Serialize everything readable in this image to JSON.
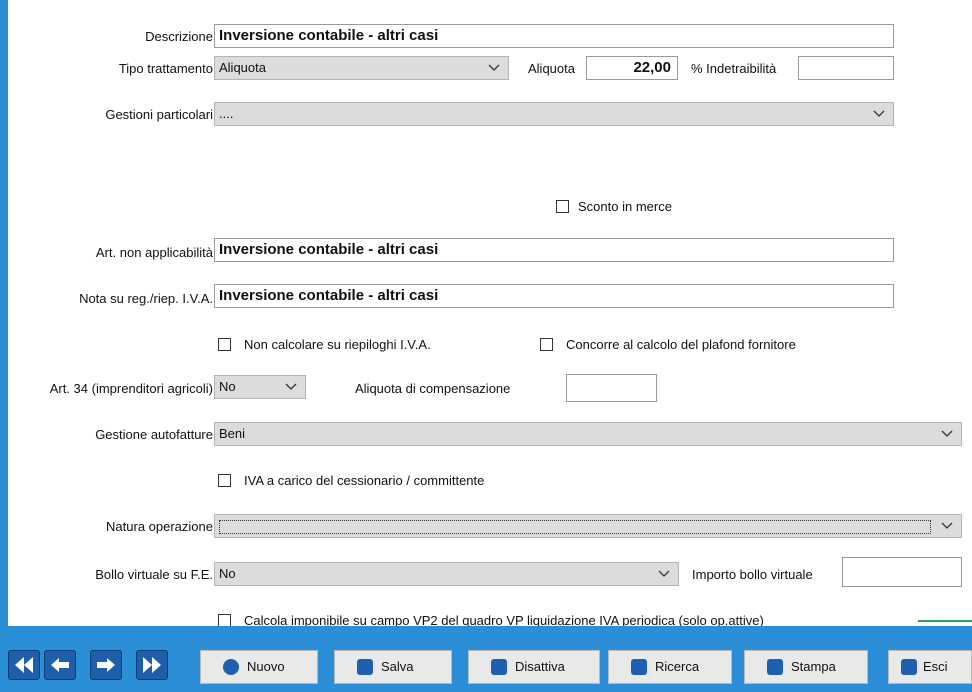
{
  "form": {
    "descrizione": {
      "label": "Descrizione",
      "value": "Inversione contabile - altri casi"
    },
    "tipo_trattamento": {
      "label": "Tipo trattamento",
      "value": "Aliquota"
    },
    "aliquota": {
      "label": "Aliquota",
      "value": "22,00"
    },
    "indetraibilita": {
      "label": "% Indetraibilità",
      "value": ""
    },
    "gestioni_particolari": {
      "label": "Gestioni particolari",
      "value": "...."
    },
    "sconto_in_merce": {
      "label": "Sconto in merce",
      "checked": false
    },
    "art_non_applicabilita": {
      "label": "Art. non applicabilità",
      "value": "Inversione contabile - altri casi"
    },
    "nota_reg": {
      "label": "Nota su reg./riep. I.V.A.",
      "value": "Inversione contabile - altri casi"
    },
    "non_calcolare": {
      "label": "Non calcolare su riepiloghi I.V.A.",
      "checked": false
    },
    "concorre_plafond": {
      "label": "Concorre al calcolo del plafond fornitore",
      "checked": false
    },
    "art34": {
      "label": "Art. 34 (imprenditori agricoli)",
      "value": "No"
    },
    "aliquota_compensazione": {
      "label": "Aliquota di compensazione",
      "value": ""
    },
    "gestione_autofatture": {
      "label": "Gestione autofatture",
      "value": "Beni"
    },
    "iva_carico": {
      "label": "IVA a carico del cessionario / committente",
      "checked": false
    },
    "natura_operazione": {
      "label": "Natura operazione",
      "value": ""
    },
    "bollo_virtuale": {
      "label": "Bollo virtuale su F.E.",
      "value": "No"
    },
    "importo_bollo": {
      "label": "Importo bollo virtuale",
      "value": ""
    },
    "calcola_imponibile": {
      "label": "Calcola imponibile su campo VP2 del quadro VP liquidazione IVA periodica (solo op.attive)",
      "checked": false
    }
  },
  "toolbar": {
    "nuovo": "Nuovo",
    "salva": "Salva",
    "disattiva": "Disattiva",
    "ricerca": "Ricerca",
    "stampa": "Stampa",
    "esci": "Esci"
  },
  "colors": {
    "frame_blue": "#2a8fd6",
    "nav_blue": "#1d5fa8",
    "combo_grey": "#dcdcdc"
  }
}
